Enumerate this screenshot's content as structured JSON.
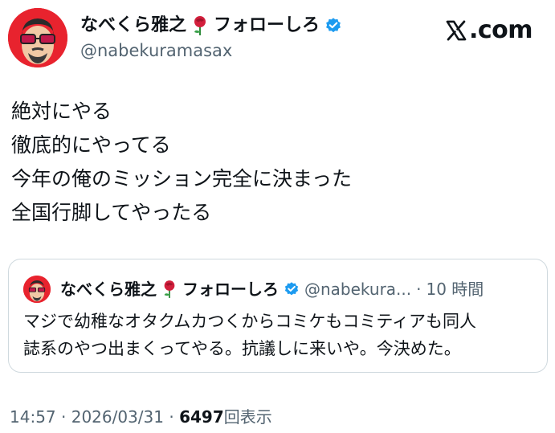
{
  "brand": {
    "label": ".com"
  },
  "author": {
    "display_name": "なべくら雅之",
    "display_name_suffix": "フォローしろ",
    "handle": "@nabekuramasax",
    "verified_color": "#1d9bf0"
  },
  "tweet": {
    "lines": [
      "絶対にやる",
      "徹底的にやってる",
      "今年の俺のミッション完全に決まった",
      "全国行脚してやったる"
    ]
  },
  "quote": {
    "display_name": "なべくら雅之",
    "display_name_suffix": "フォローしろ",
    "handle": "@nabekura...",
    "separator": "·",
    "time": "10 時間",
    "lines": [
      "マジで幼稚なオタクムカつくからコミケもコミティアも同人",
      "誌系のやつ出まくってやる。抗議しに来いや。今決めた。"
    ]
  },
  "meta": {
    "time": "14:57",
    "sep1": "·",
    "date": "2026/03/31",
    "sep2": "·",
    "views_count": "6497",
    "views_label": "回表示"
  },
  "icons": {
    "rose": "rose-emoji-icon",
    "verified": "verified-badge-icon",
    "x_logo": "x-logo-icon"
  },
  "colors": {
    "text": "#0f1419",
    "secondary": "#536471",
    "border": "#cfd9de",
    "avatar_bg": "#e8232e"
  }
}
